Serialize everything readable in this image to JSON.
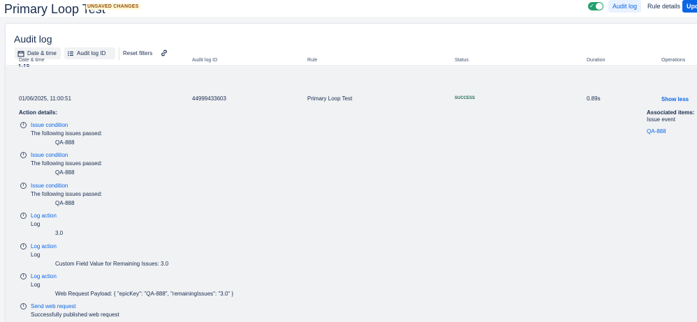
{
  "header": {
    "rule_title": "Primary Loop Test",
    "unsaved_badge": "UNSAVED CHANGES",
    "audit_log_button": "Audit log",
    "rule_details_button": "Rule details",
    "update_button": "Update"
  },
  "panel": {
    "title": "Audit log",
    "filters": {
      "date_time": "Date & time",
      "audit_log_id": "Audit log ID",
      "reset": "Reset filters"
    },
    "count": "1-19"
  },
  "table": {
    "columns": [
      "Date & time",
      "Audit log ID",
      "Rule",
      "Status",
      "Duration",
      "Operations"
    ],
    "row": {
      "date_time": "01/06/2025, 11:00:51",
      "audit_log_id": "44999433603",
      "rule": "Primary Loop Test",
      "status": "SUCCESS",
      "duration": "0.89s",
      "operation": "Show less"
    }
  },
  "details": {
    "action_details_label": "Action details:",
    "associated_items_label": "Associated items:",
    "associated_type": "Issue event",
    "associated_key": "QA-888",
    "actions": [
      {
        "title": "Issue condition",
        "desc": "The following issues passed:",
        "value": "QA-888"
      },
      {
        "title": "Issue condition",
        "desc": "The following issues passed:",
        "value": "QA-888"
      },
      {
        "title": "Issue condition",
        "desc": "The following issues passed:",
        "value": "QA-888"
      },
      {
        "title": "Log action",
        "desc": "Log",
        "value": "3.0"
      },
      {
        "title": "Log action",
        "desc": "Log",
        "value": "Custom Field Value for Remaining Issues: 3.0"
      },
      {
        "title": "Log action",
        "desc": "Log",
        "value": "Web Request Payload: { \"epicKey\": \"QA-888\", \"remainingIssues\": \"3.0\" }"
      },
      {
        "title": "Send web request",
        "desc": "Successfully published web request",
        "value": ""
      }
    ]
  },
  "colors": {
    "accent": "#0c66e4",
    "success": "#216e4e",
    "toggle_on": "#22a06b",
    "unsaved": "#974f0c"
  },
  "icons": {
    "calendar": "calendar-icon",
    "list": "list-icon",
    "link": "link-icon",
    "info": "info-icon",
    "toggle": "toggle-on-icon"
  }
}
